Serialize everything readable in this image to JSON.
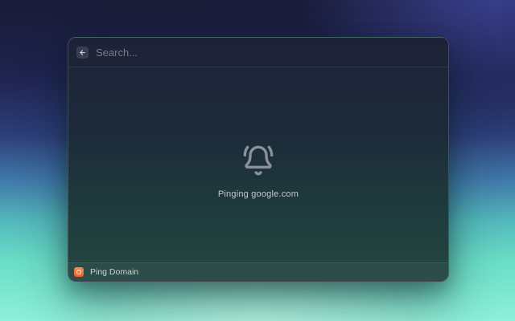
{
  "search_bar": {
    "placeholder": "Search...",
    "search_value": ""
  },
  "content": {
    "status_message": "Pinging google.com"
  },
  "footer": {
    "extension_label": "Ping Domain"
  },
  "icons": {
    "back": "back-arrow-icon",
    "status": "bell-ring-icon",
    "extension": "ping-extension-icon"
  },
  "colors": {
    "extension_icon_orange": "#ef5a2e",
    "background_top": "#191c38",
    "background_top_right": "#3e46a0",
    "background_bottom_mint": "#8df0d8",
    "window_dark": "#1e2238",
    "bell_gray": "#8b929c"
  }
}
